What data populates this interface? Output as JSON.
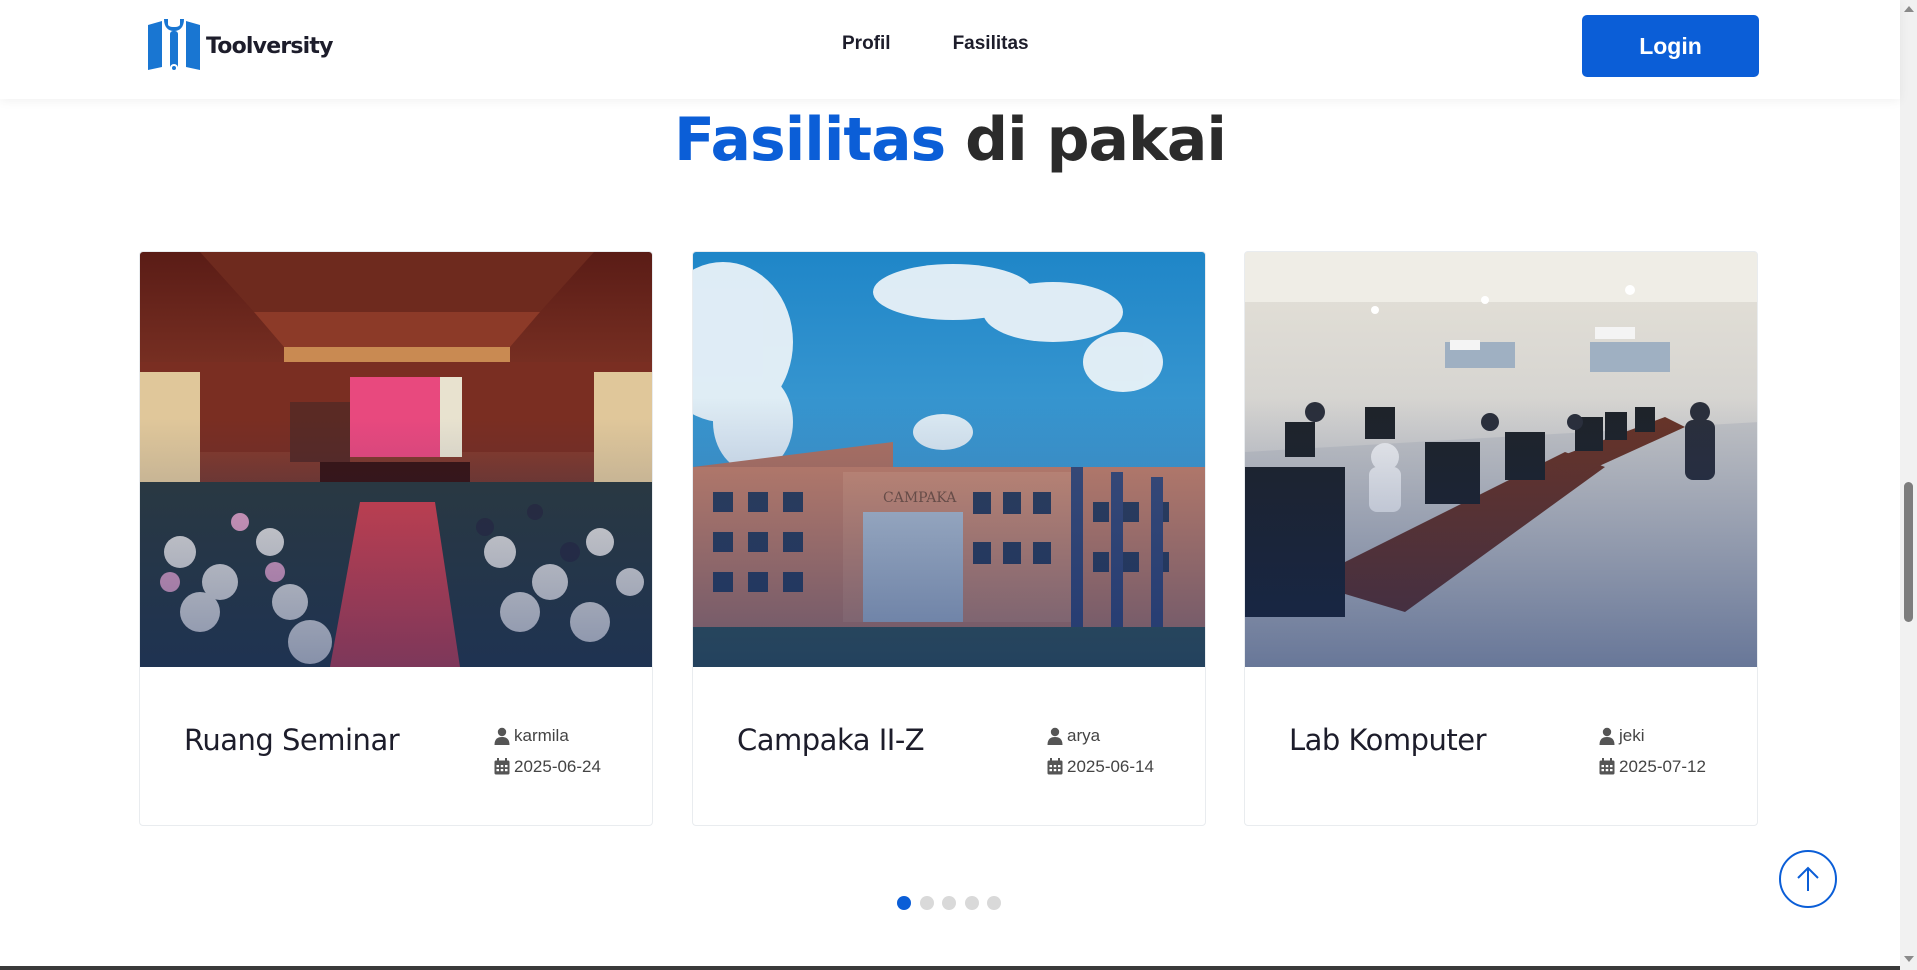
{
  "header": {
    "brand": "Toolversity",
    "nav": [
      "Profil",
      "Fasilitas"
    ],
    "login_label": "Login"
  },
  "section": {
    "title_accent": "Fasilitas",
    "title_rest": "di pakai"
  },
  "cards": [
    {
      "title": "Ruang Seminar",
      "user": "karmila",
      "date": "2025-06-24"
    },
    {
      "title": "Campaka II-Z",
      "user": "arya",
      "date": "2025-06-14"
    },
    {
      "title": "Lab Komputer",
      "user": "jeki",
      "date": "2025-07-12"
    }
  ],
  "carousel": {
    "dot_count": 5,
    "active_index": 0
  },
  "colors": {
    "accent": "#0b5ed7",
    "text": "#1d1d2b"
  }
}
